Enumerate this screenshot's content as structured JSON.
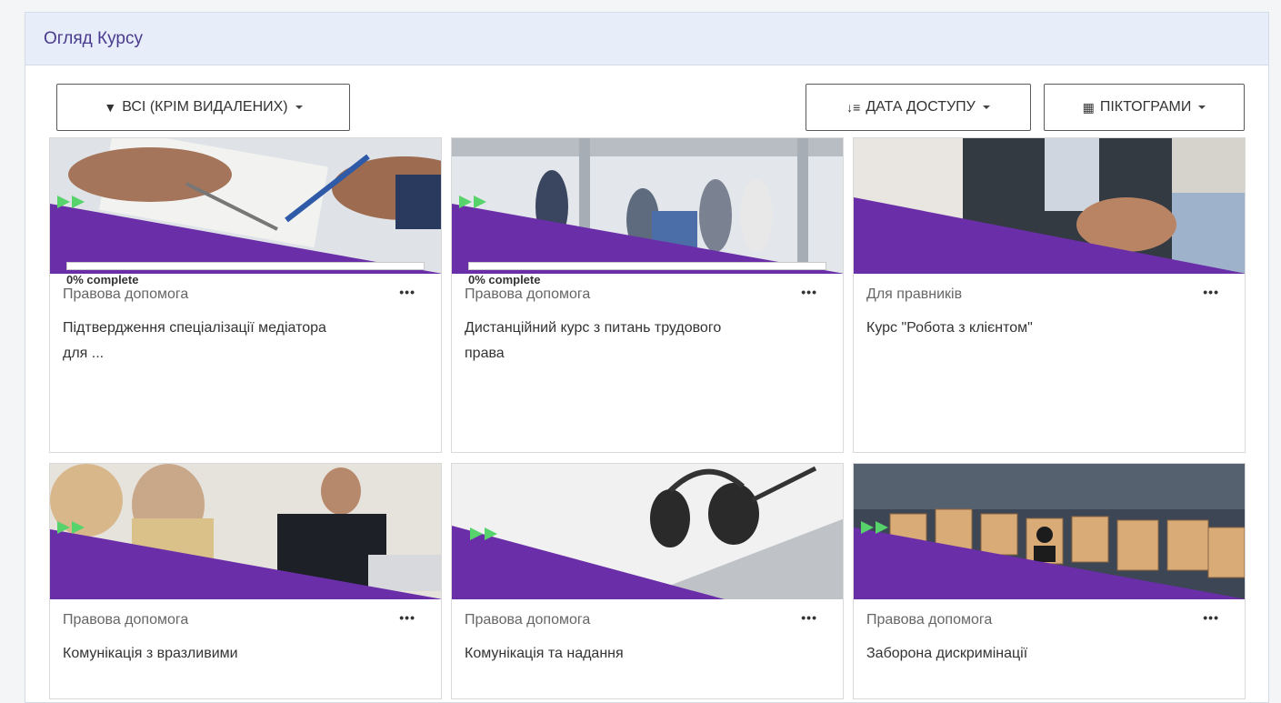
{
  "block": {
    "title": "Огляд Курсу"
  },
  "toolbar": {
    "filter_label": "ВСІ (КРІМ ВИДАЛЕНИХ)",
    "sort_label": "ДАТА ДОСТУПУ",
    "view_label": "ПІКТОГРАМИ",
    "filter_icon": "filter-icon",
    "sort_icon": "sort-icon",
    "view_icon": "grid-icon"
  },
  "colors": {
    "accent": "#4a3a8e",
    "purple": "#6a2fa8",
    "green": "#57d36b"
  },
  "courses": [
    {
      "category": "Правова допомога",
      "name": "Підтвердження спеціалізації медіатора для ...",
      "progress": 0,
      "progress_text": "0% complete",
      "menu": "•••"
    },
    {
      "category": "Правова допомога",
      "name": "Дистанційний курс з питань трудового права",
      "progress": 0,
      "progress_text": "0% complete",
      "menu": "•••"
    },
    {
      "category": "Для правників",
      "name": "Курс \"Робота з клієнтом\"",
      "progress": null,
      "progress_text": null,
      "menu": "•••"
    },
    {
      "category": "Правова допомога",
      "name": "Комунікація з вразливими",
      "progress": null,
      "progress_text": null,
      "menu": "•••"
    },
    {
      "category": "Правова допомога",
      "name": "Комунікація та надання",
      "progress": null,
      "progress_text": null,
      "menu": "•••"
    },
    {
      "category": "Правова допомога",
      "name": "Заборона дискримінації",
      "progress": null,
      "progress_text": null,
      "menu": "•••"
    }
  ]
}
